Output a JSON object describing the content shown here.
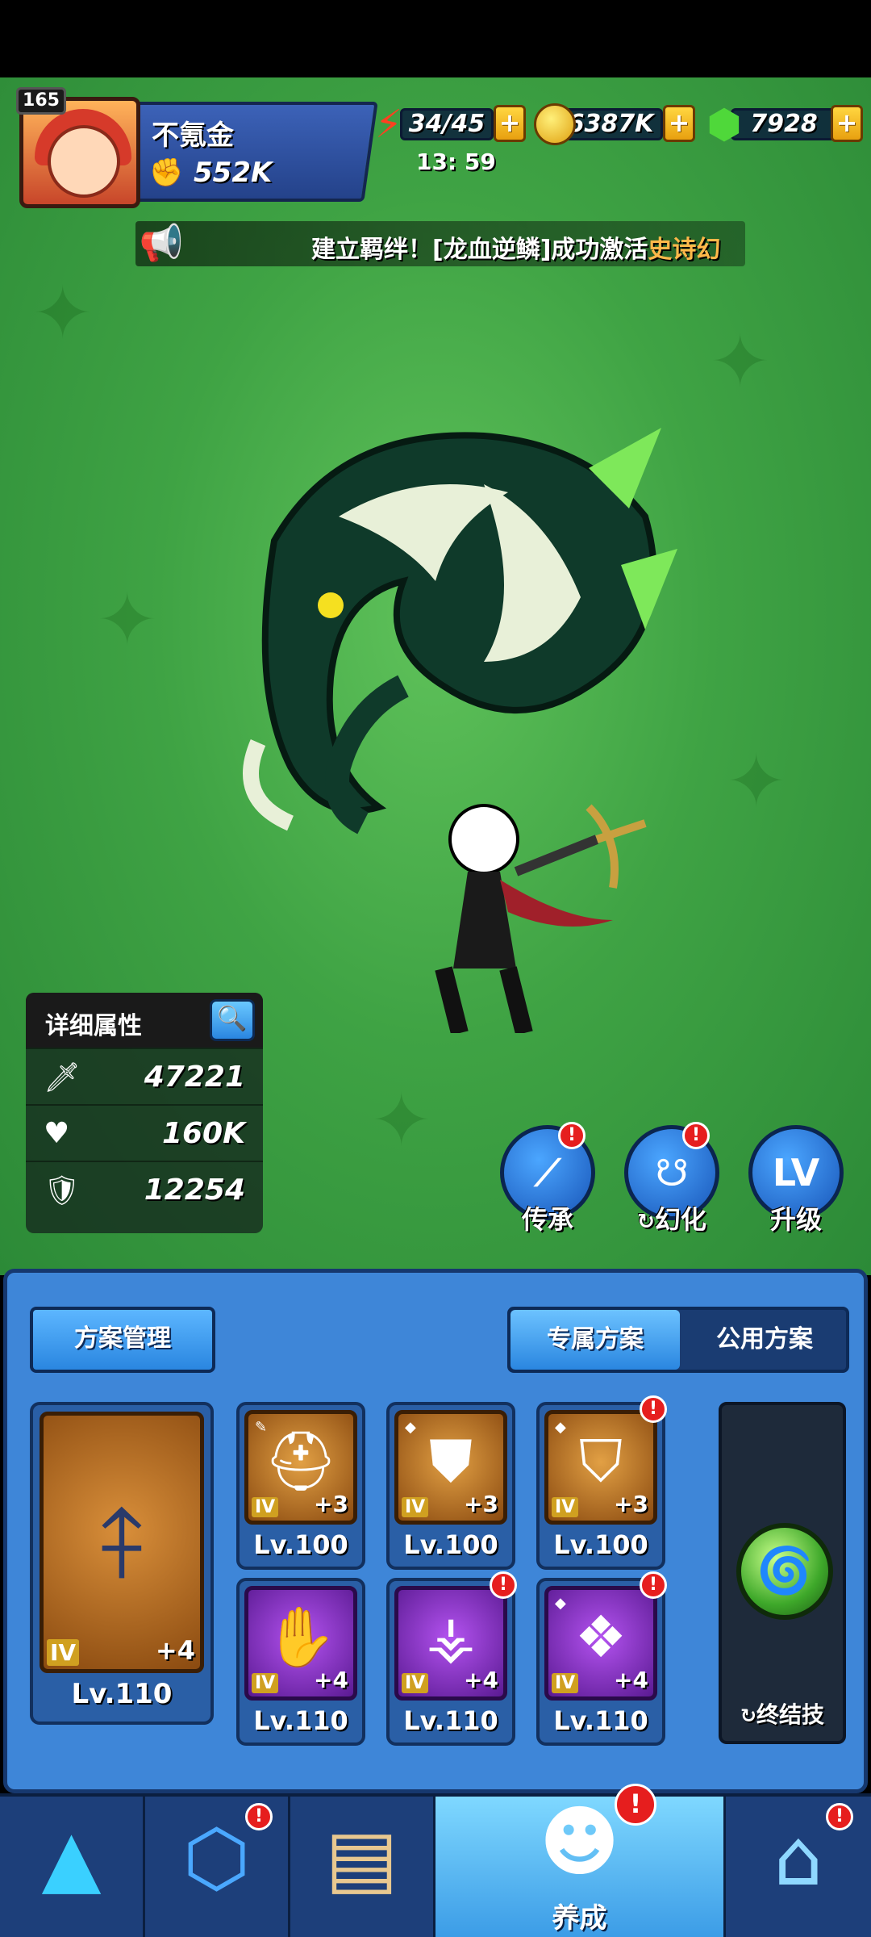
{
  "player": {
    "level": "165",
    "name": "不氪金",
    "power": "552K",
    "power_icon": "fist-icon"
  },
  "resources": {
    "energy": "34/45",
    "energy_timer": "13: 59",
    "gold": "6387K",
    "gems": "7928"
  },
  "broadcast": {
    "prefix": "建立羁绊！[龙血逆鳞]成功激活",
    "highlight": "史诗幻"
  },
  "stats": {
    "title": "详细属性",
    "attack": "47221",
    "hp": "160K",
    "defense": "12254"
  },
  "actions": [
    {
      "label": "传承",
      "icon": "nodes-icon",
      "badge": "!"
    },
    {
      "label": "幻化",
      "icon": "dragon-head-icon",
      "badge": "!"
    },
    {
      "label": "升级",
      "icon": "lv-up-icon",
      "glyph": "LV"
    }
  ],
  "panel": {
    "plan_button": "方案管理",
    "tab_exclusive": "专属方案",
    "tab_public": "公用方案",
    "weapon": {
      "rank": "IV",
      "plus": "+4",
      "level": "Lv.110"
    },
    "gear": [
      {
        "rank": "IV",
        "plus": "+3",
        "level": "Lv.100",
        "type": "gold",
        "icon": "helmet-icon"
      },
      {
        "rank": "IV",
        "plus": "+3",
        "level": "Lv.100",
        "type": "gold",
        "icon": "armor-icon",
        "badge": ""
      },
      {
        "rank": "IV",
        "plus": "+3",
        "level": "Lv.100",
        "type": "gold",
        "icon": "belt-icon",
        "badge": "!"
      },
      {
        "rank": "IV",
        "plus": "+4",
        "level": "Lv.110",
        "type": "purple",
        "icon": "gauntlet-icon"
      },
      {
        "rank": "IV",
        "plus": "+4",
        "level": "Lv.110",
        "type": "purple",
        "icon": "boots-icon",
        "badge": "!"
      },
      {
        "rank": "IV",
        "plus": "+4",
        "level": "Lv.110",
        "type": "purple",
        "icon": "amulet-icon",
        "badge": "!"
      }
    ],
    "ultimate_label": "终结技"
  },
  "nav": [
    {
      "label": "",
      "icon": "crystal-icon"
    },
    {
      "label": "",
      "icon": "rune-hexagon-icon",
      "badge": "!"
    },
    {
      "label": "",
      "icon": "treasure-map-icon"
    },
    {
      "label": "养成",
      "icon": "character-icon",
      "badge": "!",
      "active": true
    },
    {
      "label": "",
      "icon": "store-icon",
      "badge": "!"
    }
  ],
  "colors": {
    "accent_blue": "#3e86d8",
    "scene_green": "#3fa344",
    "badge_red": "#e61e1e",
    "highlight_orange": "#ffb84a"
  }
}
